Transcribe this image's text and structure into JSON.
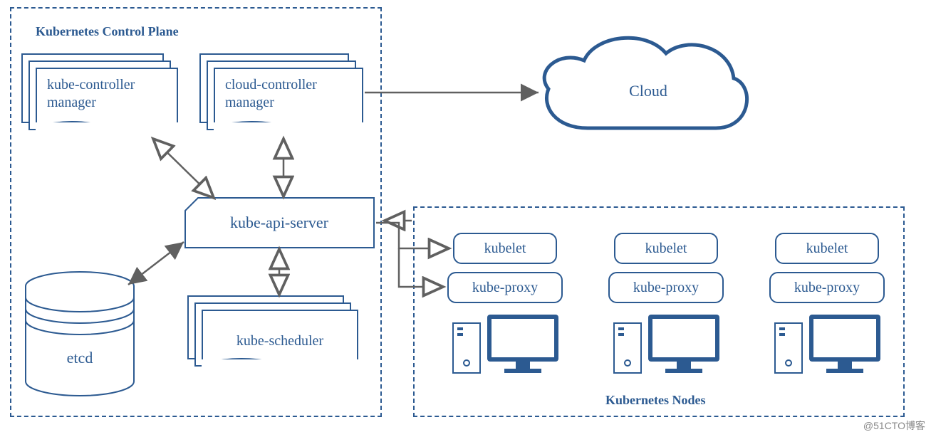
{
  "diagram": {
    "title_control_plane": "Kubernetes Control Plane",
    "title_nodes": "Kubernetes Nodes",
    "cloud_label": "Cloud",
    "etcd_label": "etcd",
    "api_server_label": "kube-api-server",
    "controllers": {
      "kube_controller_line1": "kube-controller",
      "kube_controller_line2": "manager",
      "cloud_controller_line1": "cloud-controller",
      "cloud_controller_line2": "manager",
      "scheduler_label": "kube-scheduler"
    },
    "nodes": [
      {
        "kubelet": "kubelet",
        "proxy": "kube-proxy"
      },
      {
        "kubelet": "kubelet",
        "proxy": "kube-proxy"
      },
      {
        "kubelet": "kubelet",
        "proxy": "kube-proxy"
      }
    ]
  },
  "colors": {
    "primary": "#2c5a91",
    "primary_light": "#3a6da8",
    "arrow": "#606060"
  },
  "watermark": "@51CTO博客"
}
